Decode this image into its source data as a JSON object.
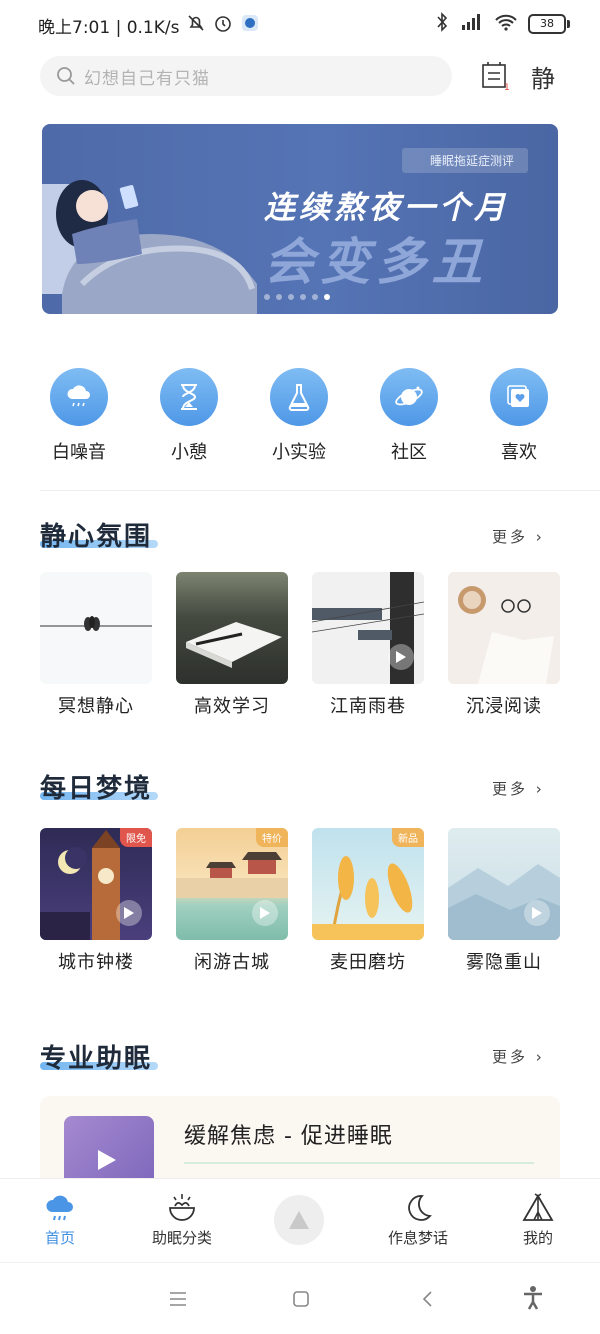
{
  "status": {
    "time_speed": "晚上7:01 | 0.1K/s",
    "battery": "38"
  },
  "search": {
    "placeholder": "幻想自己有只猫"
  },
  "header": {
    "icon_badge": "1",
    "right_icon_label": "静"
  },
  "banner": {
    "tag": "睡眠拖延症测评",
    "title_line1": "连续熬夜一个月",
    "title_line2": "会变多丑",
    "dots": 6,
    "active_dot": 5
  },
  "quick": [
    {
      "label": "白噪音",
      "icon": "rain-cloud-icon"
    },
    {
      "label": "小憩",
      "icon": "hourglass-icon"
    },
    {
      "label": "小实验",
      "icon": "flask-icon"
    },
    {
      "label": "社区",
      "icon": "planet-icon"
    },
    {
      "label": "喜欢",
      "icon": "heart-card-icon"
    }
  ],
  "sections": {
    "calm": {
      "title": "静心氛围",
      "more": "更多 ›",
      "items": [
        {
          "label": "冥想静心"
        },
        {
          "label": "高效学习"
        },
        {
          "label": "江南雨巷"
        },
        {
          "label": "沉浸阅读"
        }
      ]
    },
    "dream": {
      "title": "每日梦境",
      "more": "更多 ›",
      "items": [
        {
          "label": "城市钟楼",
          "badge": "限免"
        },
        {
          "label": "闲游古城",
          "badge": "特价"
        },
        {
          "label": "麦田磨坊",
          "badge": "新品"
        },
        {
          "label": "雾隐重山",
          "badge": ""
        }
      ]
    },
    "pro": {
      "title": "专业助眠",
      "more": "更多 ›",
      "card_title": "缓解焦虑 - 促进睡眠"
    }
  },
  "nav": [
    {
      "label": "首页",
      "active": true
    },
    {
      "label": "助眠分类"
    },
    {
      "label": "作息梦话"
    },
    {
      "label": "我的"
    }
  ],
  "colors": {
    "accent": "#4f98e7",
    "banner": "#4f6aa8"
  }
}
